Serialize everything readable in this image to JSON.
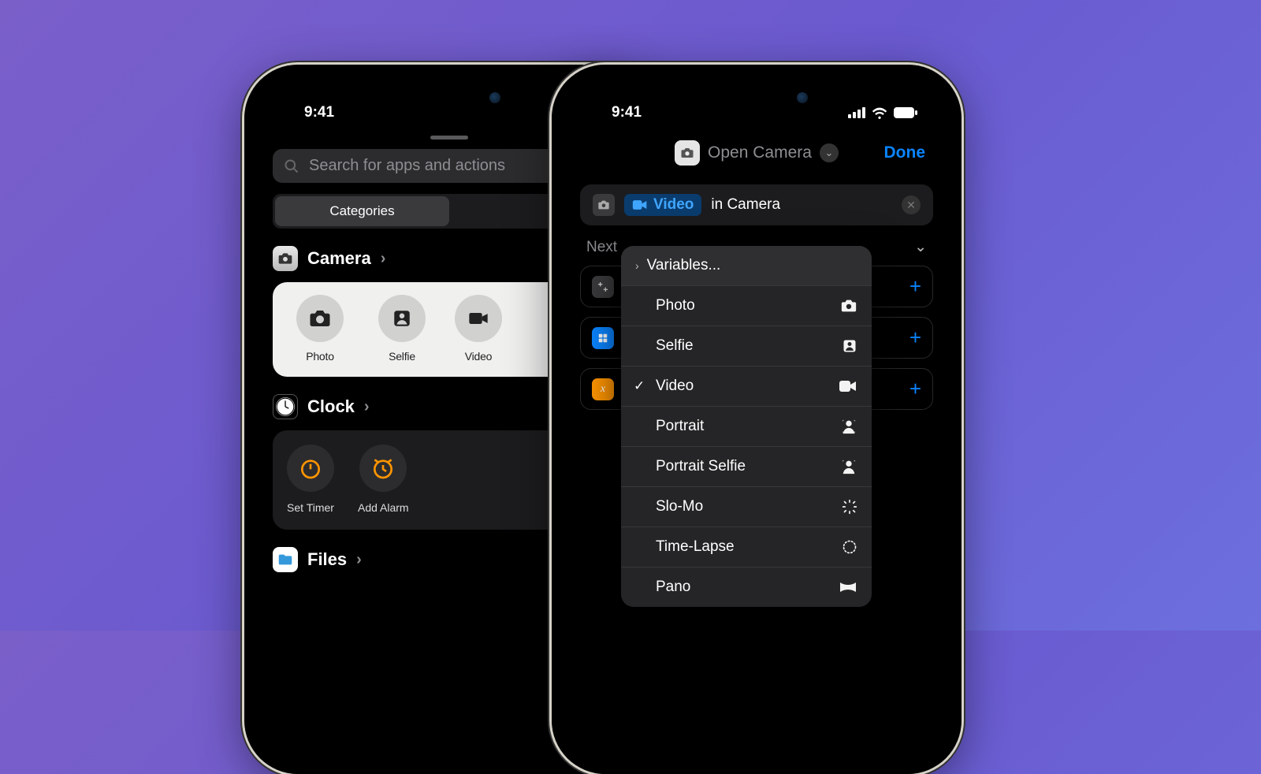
{
  "status": {
    "time": "9:41"
  },
  "left": {
    "search_placeholder": "Search for apps and actions",
    "tab_categories": "Categories",
    "camera": {
      "title": "Camera",
      "items": [
        "Photo",
        "Selfie",
        "Video"
      ]
    },
    "clock": {
      "title": "Clock",
      "items": [
        "Set Timer",
        "Add Alarm"
      ]
    },
    "files": {
      "title": "Files"
    }
  },
  "right": {
    "nav": {
      "title": "Open Camera",
      "done": "Done"
    },
    "action": {
      "pill": "Video",
      "suffix": "in Camera"
    },
    "next_label": "Next",
    "popover": {
      "variables": "Variables...",
      "options": [
        {
          "label": "Photo",
          "icon": "camera",
          "checked": false
        },
        {
          "label": "Selfie",
          "icon": "selfie",
          "checked": false
        },
        {
          "label": "Video",
          "icon": "video",
          "checked": true
        },
        {
          "label": "Portrait",
          "icon": "portrait",
          "checked": false
        },
        {
          "label": "Portrait Selfie",
          "icon": "portrait",
          "checked": false
        },
        {
          "label": "Slo-Mo",
          "icon": "spinner",
          "checked": false
        },
        {
          "label": "Time-Lapse",
          "icon": "spinner",
          "checked": false
        },
        {
          "label": "Pano",
          "icon": "pano",
          "checked": false
        }
      ]
    }
  }
}
